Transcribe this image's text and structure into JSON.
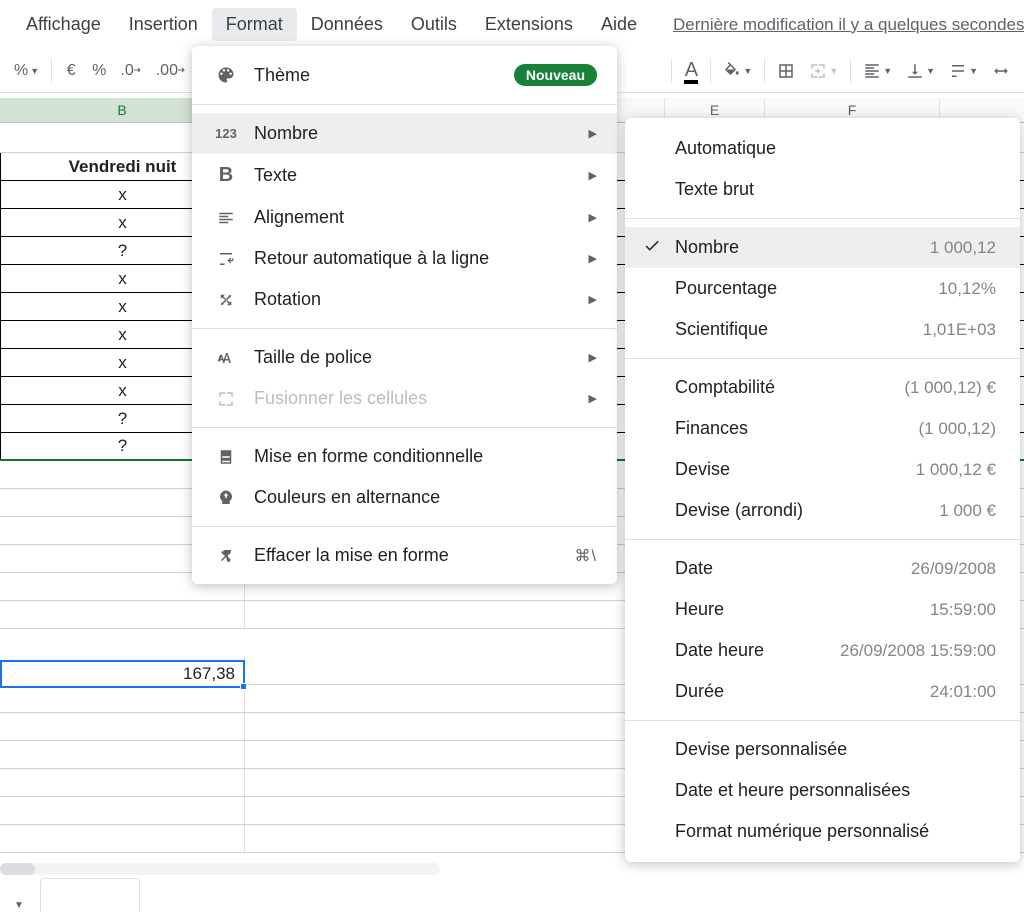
{
  "menubar": {
    "items": [
      "Affichage",
      "Insertion",
      "Format",
      "Données",
      "Outils",
      "Extensions",
      "Aide"
    ],
    "active_index": 2,
    "last_modified": "Dernière modification il y a quelques secondes"
  },
  "toolbar": {
    "percent_format": "%",
    "currency_symbol": "€",
    "percent_symbol": "%",
    "decrease_decimal": ".0",
    "increase_decimal": ".00"
  },
  "columns": [
    "B",
    "E",
    "F"
  ],
  "selected_column_index": 0,
  "table": {
    "header": "Vendredi nuit",
    "rows": [
      "x",
      "x",
      "?",
      "x",
      "x",
      "x",
      "x",
      "x",
      "?",
      "?"
    ]
  },
  "selected_cell": {
    "value": "167,38"
  },
  "format_menu": {
    "items": [
      {
        "icon": "palette",
        "label": "Thème",
        "badge": "Nouveau"
      },
      {
        "sep": true
      },
      {
        "icon": "123",
        "label": "Nombre",
        "arrow": true,
        "highlighted": true
      },
      {
        "icon": "bold",
        "label": "Texte",
        "arrow": true
      },
      {
        "icon": "align",
        "label": "Alignement",
        "arrow": true
      },
      {
        "icon": "wrap",
        "label": "Retour automatique à la ligne",
        "arrow": true
      },
      {
        "icon": "rotate",
        "label": "Rotation",
        "arrow": true
      },
      {
        "sep": true
      },
      {
        "icon": "fontsize",
        "label": "Taille de police",
        "arrow": true
      },
      {
        "icon": "merge",
        "label": "Fusionner les cellules",
        "arrow": true,
        "disabled": true
      },
      {
        "sep": true
      },
      {
        "icon": "condformat",
        "label": "Mise en forme conditionnelle"
      },
      {
        "icon": "altcolors",
        "label": "Couleurs en alternance"
      },
      {
        "sep": true
      },
      {
        "icon": "clear",
        "label": "Effacer la mise en forme",
        "shortcut": "⌘\\"
      }
    ]
  },
  "number_menu": {
    "items": [
      {
        "label": "Automatique"
      },
      {
        "label": "Texte brut"
      },
      {
        "sep": true
      },
      {
        "label": "Nombre",
        "example": "1 000,12",
        "checked": true,
        "highlighted": true
      },
      {
        "label": "Pourcentage",
        "example": "10,12%"
      },
      {
        "label": "Scientifique",
        "example": "1,01E+03"
      },
      {
        "sep": true
      },
      {
        "label": "Comptabilité",
        "example": "(1 000,12) €"
      },
      {
        "label": "Finances",
        "example": "(1 000,12)"
      },
      {
        "label": "Devise",
        "example": "1 000,12 €"
      },
      {
        "label": "Devise (arrondi)",
        "example": "1 000 €"
      },
      {
        "sep": true
      },
      {
        "label": "Date",
        "example": "26/09/2008"
      },
      {
        "label": "Heure",
        "example": "15:59:00"
      },
      {
        "label": "Date heure",
        "example": "26/09/2008 15:59:00"
      },
      {
        "label": "Durée",
        "example": "24:01:00"
      },
      {
        "sep": true
      },
      {
        "label": "Devise personnalisée"
      },
      {
        "label": "Date et heure personnalisées"
      },
      {
        "label": "Format numérique personnalisé"
      }
    ]
  }
}
